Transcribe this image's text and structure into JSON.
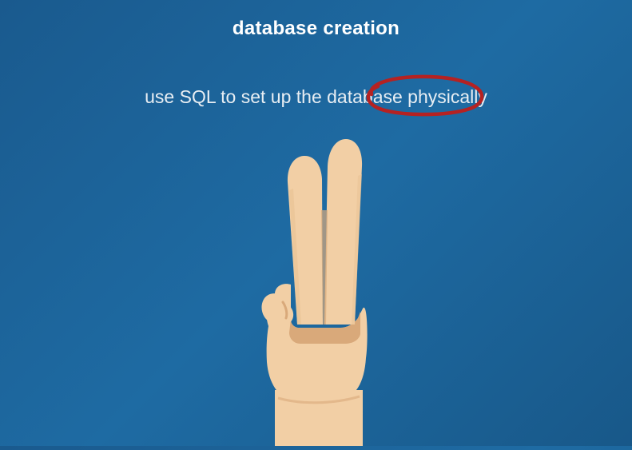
{
  "title": "database creation",
  "subtitle": "use SQL to set up the database physically",
  "emphasis_word": "physically",
  "colors": {
    "background": "#1a5f96",
    "text": "#ffffff",
    "annotation": "#b52222",
    "skin": "#f2cfa5",
    "skin_shadow": "#d9a97a"
  },
  "icon": "peace-sign-hand"
}
